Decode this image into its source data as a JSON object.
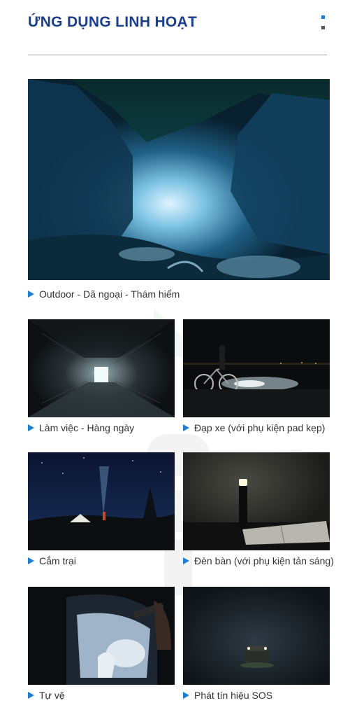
{
  "header": {
    "title": "ỨNG DỤNG LINH HOẠT",
    "accent_color": "#1a3f8f",
    "dot_colors": [
      "#1e7fd0",
      "#555555"
    ]
  },
  "hero": {
    "caption": "Outdoor - Dã ngoại - Thám hiểm",
    "image_subject": "ice-cave-photo"
  },
  "grid": [
    {
      "caption": "Làm việc - Hàng ngày",
      "image_subject": "tunnel-photo"
    },
    {
      "caption": "Đạp xe (với phụ kiện pad kẹp)",
      "image_subject": "cyclist-photo"
    },
    {
      "caption": "Cắm trại",
      "image_subject": "camping-photo"
    },
    {
      "caption": "Đèn bàn (với phụ kiện tản sáng)",
      "image_subject": "desk-lamp-photo"
    },
    {
      "caption": "Tự vệ",
      "image_subject": "self-defense-photo"
    },
    {
      "caption": "Phát tín hiệu SOS",
      "image_subject": "sos-signal-photo"
    }
  ],
  "bullet_color": "#1e7fd0"
}
